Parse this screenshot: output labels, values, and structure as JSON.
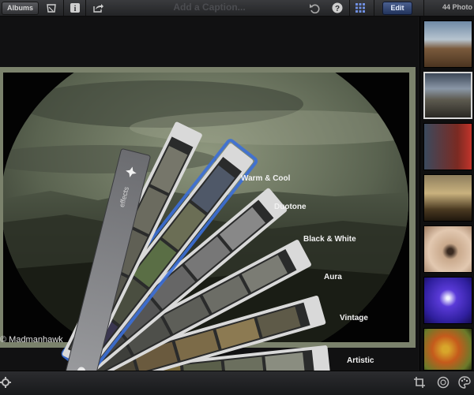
{
  "toolbar": {
    "albums_label": "Albums",
    "caption_placeholder": "Add a Caption...",
    "edit_label": "Edit",
    "photo_count_label": "44 Photo"
  },
  "photo": {
    "copyright": "© Madmanhawk"
  },
  "effects": {
    "handle_label": "effects",
    "options": [
      {
        "label": "Warm & Cool"
      },
      {
        "label": "Duotone"
      },
      {
        "label": "Black & White"
      },
      {
        "label": "Aura"
      },
      {
        "label": "Vintage"
      },
      {
        "label": "Artistic"
      }
    ]
  },
  "colors": {
    "accent": "#3b6fd8",
    "frame": "#7b826c",
    "tint": "#5f6a55"
  },
  "icons": [
    "trash-icon",
    "info-icon",
    "share-icon",
    "undo-icon",
    "help-icon",
    "grid-icon",
    "gear-icon",
    "crop-icon",
    "enhance-icon",
    "palette-icon",
    "sparkle-icon"
  ]
}
